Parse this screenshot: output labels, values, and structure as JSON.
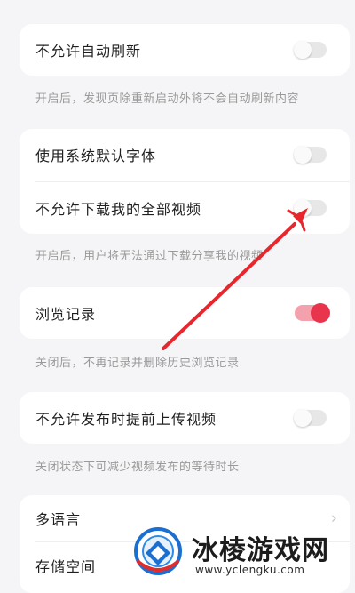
{
  "settings": {
    "group1": {
      "row1": {
        "label": "不允许自动刷新",
        "toggle": "off"
      },
      "hint": "开启后，发现页除重新启动外将不会自动刷新内容"
    },
    "group2": {
      "row1": {
        "label": "使用系统默认字体",
        "toggle": "off"
      },
      "row2": {
        "label": "不允许下载我的全部视频",
        "toggle": "off"
      },
      "hint": "开启后，用户将无法通过下载分享我的视频"
    },
    "group3": {
      "row1": {
        "label": "浏览记录",
        "toggle": "on"
      },
      "hint": "关闭后，不再记录并删除历史浏览记录"
    },
    "group4": {
      "row1": {
        "label": "不允许发布时提前上传视频",
        "toggle": "off"
      },
      "hint": "关闭状态下可减少视频发布的等待时长"
    },
    "group5": {
      "row1": {
        "label": "多语言",
        "chevron": "chevron-right-icon"
      },
      "row2": {
        "label": "存储空间"
      }
    }
  },
  "annotation": {
    "arrow_color": "#e8262d"
  },
  "watermark": {
    "title": "冰棱游戏网",
    "url": "www.yclengku.com"
  },
  "colors": {
    "accent": "#e8344c",
    "background": "#f5f5f7"
  }
}
